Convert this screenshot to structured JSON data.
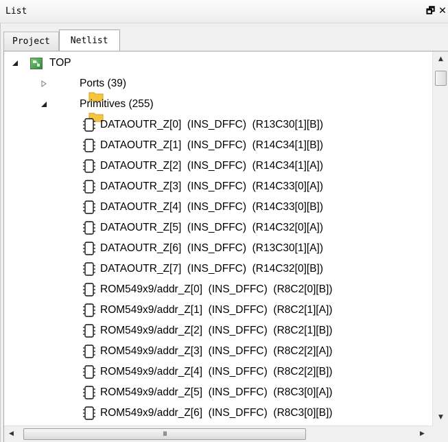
{
  "window": {
    "title": "List",
    "restore_glyph": "🗗",
    "close_glyph": "✕"
  },
  "tabs": [
    {
      "label": "Project",
      "active": false
    },
    {
      "label": "Netlist",
      "active": true
    }
  ],
  "tree": {
    "root": {
      "label": "TOP",
      "expanded": true,
      "icon": "design-top-icon"
    },
    "ports": {
      "label": "Ports (39)",
      "expanded": false,
      "icon": "folder-icon"
    },
    "primitives": {
      "label": "Primitives (255)",
      "expanded": true,
      "icon": "folder-icon"
    },
    "items": [
      {
        "name": "DATAOUTR_Z[0]",
        "type": "(INS_DFFC)",
        "loc": "(R13C30[1][B])"
      },
      {
        "name": "DATAOUTR_Z[1]",
        "type": "(INS_DFFC)",
        "loc": "(R14C34[1][B])"
      },
      {
        "name": "DATAOUTR_Z[2]",
        "type": "(INS_DFFC)",
        "loc": "(R14C34[1][A])"
      },
      {
        "name": "DATAOUTR_Z[3]",
        "type": "(INS_DFFC)",
        "loc": "(R14C33[0][A])"
      },
      {
        "name": "DATAOUTR_Z[4]",
        "type": "(INS_DFFC)",
        "loc": "(R14C33[0][B])"
      },
      {
        "name": "DATAOUTR_Z[5]",
        "type": "(INS_DFFC)",
        "loc": "(R14C32[0][A])"
      },
      {
        "name": "DATAOUTR_Z[6]",
        "type": "(INS_DFFC)",
        "loc": "(R13C30[1][A])"
      },
      {
        "name": "DATAOUTR_Z[7]",
        "type": "(INS_DFFC)",
        "loc": "(R14C32[0][B])"
      },
      {
        "name": "ROM549x9/addr_Z[0]",
        "type": "(INS_DFFC)",
        "loc": "(R8C2[0][B])"
      },
      {
        "name": "ROM549x9/addr_Z[1]",
        "type": "(INS_DFFC)",
        "loc": "(R8C2[1][A])"
      },
      {
        "name": "ROM549x9/addr_Z[2]",
        "type": "(INS_DFFC)",
        "loc": "(R8C2[1][B])"
      },
      {
        "name": "ROM549x9/addr_Z[3]",
        "type": "(INS_DFFC)",
        "loc": "(R8C2[2][A])"
      },
      {
        "name": "ROM549x9/addr_Z[4]",
        "type": "(INS_DFFC)",
        "loc": "(R8C2[2][B])"
      },
      {
        "name": "ROM549x9/addr_Z[5]",
        "type": "(INS_DFFC)",
        "loc": "(R8C3[0][A])"
      },
      {
        "name": "ROM549x9/addr_Z[6]",
        "type": "(INS_DFFC)",
        "loc": "(R8C3[0][B])"
      }
    ]
  },
  "scrollbar": {
    "h_thumb_grip": "III"
  },
  "colors": {
    "folder": "#f5c542",
    "top_icon": "#4aa04a"
  }
}
